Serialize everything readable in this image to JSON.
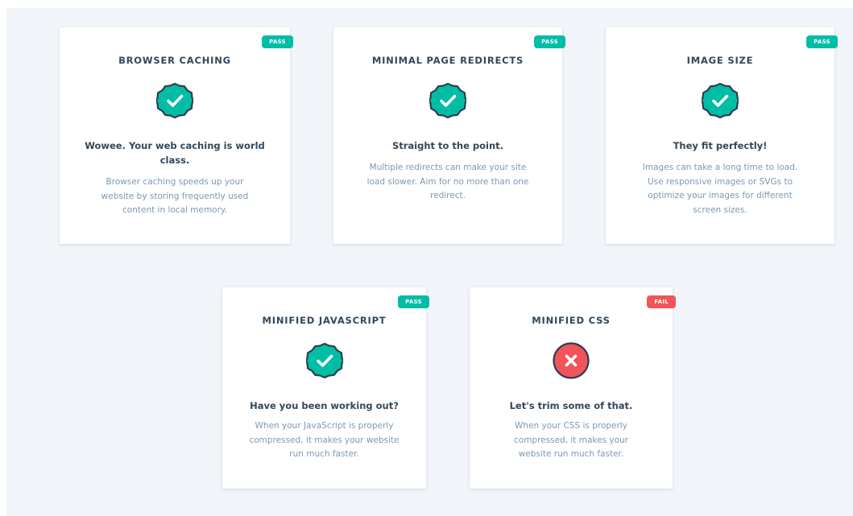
{
  "colors": {
    "pass": "#00bda5",
    "fail": "#f2545b",
    "heading": "#33475b",
    "body_text": "#7c98b6",
    "page_background": "#f1f4f8"
  },
  "cards": [
    {
      "title": "BROWSER CACHING",
      "status": "PASS",
      "icon": "check-badge-icon",
      "headline": "Wowee. Your web caching is world class.",
      "description": "Browser caching speeds up your website by storing frequently used content in local memory."
    },
    {
      "title": "MINIMAL PAGE REDIRECTS",
      "status": "PASS",
      "icon": "check-badge-icon",
      "headline": "Straight to the point.",
      "description": "Multiple redirects can make your site load slower. Aim for no more than one redirect."
    },
    {
      "title": "IMAGE SIZE",
      "status": "PASS",
      "icon": "check-badge-icon",
      "headline": "They fit perfectly!",
      "description": "Images can take a long time to load. Use responsive images or SVGs to optimize your images for different screen sizes."
    },
    {
      "title": "MINIFIED JAVASCRIPT",
      "status": "PASS",
      "icon": "check-badge-icon",
      "headline": "Have you been working out?",
      "description": "When your JavaScript is properly compressed, it makes your website run much faster."
    },
    {
      "title": "MINIFIED CSS",
      "status": "FAIL",
      "icon": "x-circle-icon",
      "headline": "Let's trim some of that.",
      "description": "When your CSS is properly compressed, it makes your website run much faster."
    }
  ]
}
